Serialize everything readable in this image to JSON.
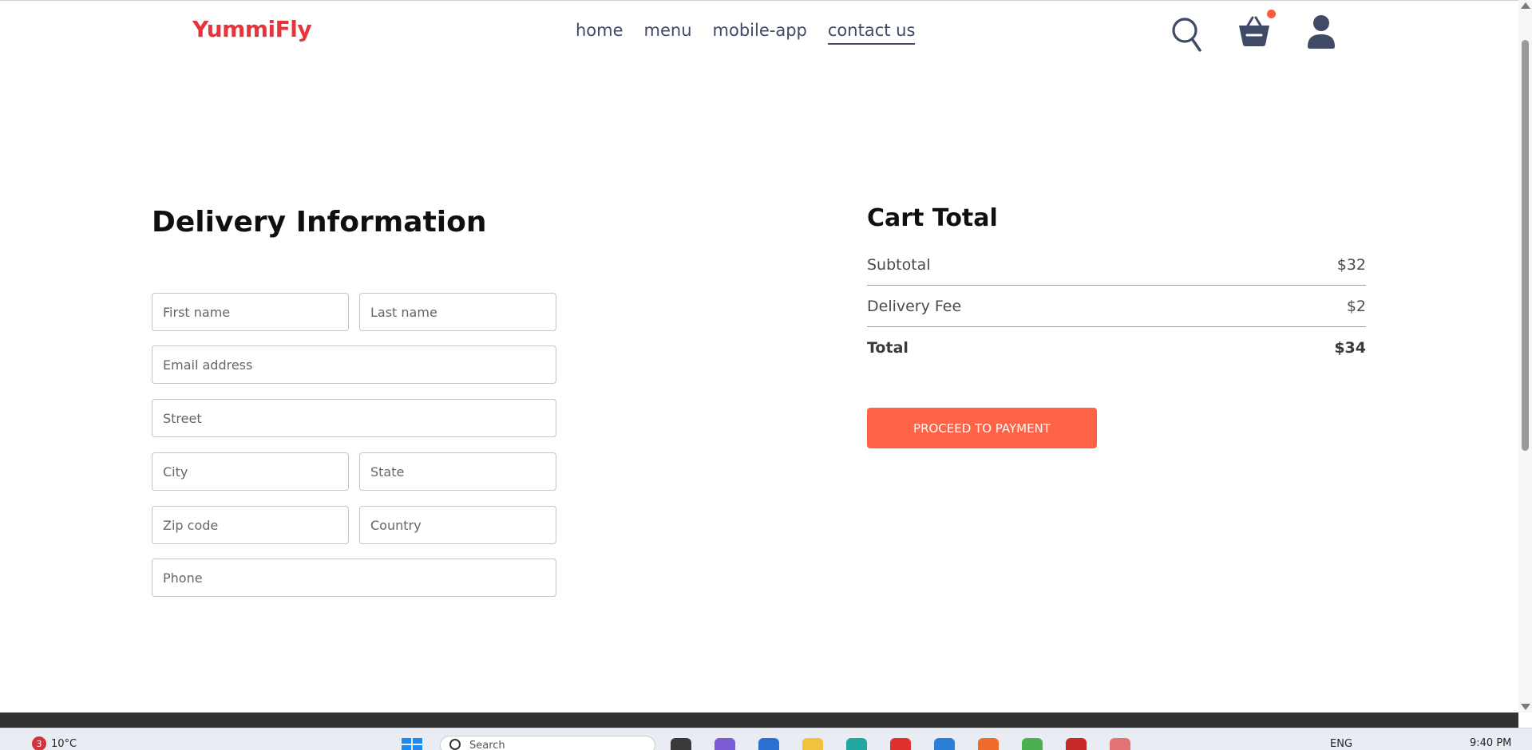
{
  "brand": {
    "name": "YummiFly",
    "color": "#e8333a"
  },
  "nav": {
    "items": [
      {
        "label": "home",
        "active": false
      },
      {
        "label": "menu",
        "active": false
      },
      {
        "label": "mobile-app",
        "active": false
      },
      {
        "label": "contact us",
        "active": true
      }
    ]
  },
  "header_icons": [
    "search-icon",
    "basket-icon",
    "user-icon"
  ],
  "delivery": {
    "title": "Delivery Information",
    "fields": {
      "first_name": "First name",
      "last_name": "Last name",
      "email": "Email address",
      "street": "Street",
      "city": "City",
      "state": "State",
      "zip": "Zip code",
      "country": "Country",
      "phone": "Phone"
    }
  },
  "cart": {
    "title": "Cart Total",
    "subtotal_label": "Subtotal",
    "subtotal_value": "$32",
    "fee_label": "Delivery Fee",
    "fee_value": "$2",
    "total_label": "Total",
    "total_value": "$34",
    "button_label": "PROCEED TO PAYMENT",
    "button_color": "#ff6347"
  },
  "taskbar": {
    "weather_badge": "3",
    "temperature": "10°C",
    "search_placeholder": "Search",
    "language": "ENG",
    "time": "9:40 PM"
  }
}
